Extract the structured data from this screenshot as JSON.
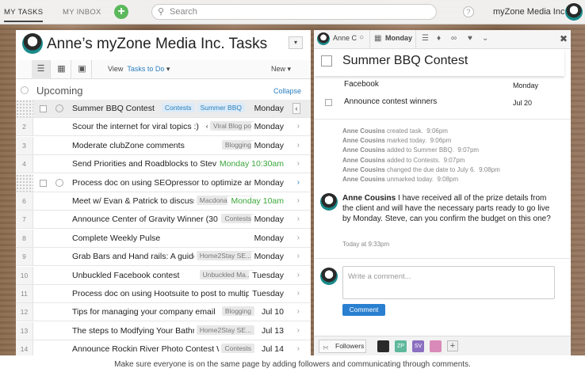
{
  "topbar": {
    "my_tasks": "MY TASKS",
    "my_inbox": "MY INBOX",
    "add": "+",
    "search_placeholder": "Search",
    "help": "?",
    "workspace": "myZone Media Inc."
  },
  "left": {
    "title": "Anne’s myZone Media Inc. Tasks",
    "dropdown": "▾",
    "view_label": "View",
    "view_value": "Tasks to Do",
    "new_label": "New",
    "upcoming": "Upcoming",
    "collapse": "Collapse",
    "rows": [
      {
        "num": "",
        "title": "Summer BBQ Contest",
        "tags": [
          "Contests",
          "Summer BBQ"
        ],
        "tag_style": "blue",
        "date": "Monday",
        "green": false,
        "selected": true
      },
      {
        "num": "2",
        "title": "Scour the internet for viral topics :)",
        "tags": [
          "Viral Blog po"
        ],
        "tag_style": "grey",
        "date": "Monday",
        "green": false
      },
      {
        "num": "3",
        "title": "Moderate clubZone comments",
        "tags": [
          "Blogging"
        ],
        "tag_style": "grey",
        "date": "Monday",
        "green": false
      },
      {
        "num": "4",
        "title": "Send Priorities and Roadblocks to Steve",
        "tags": [],
        "date": "Monday 10:30am",
        "green": true
      },
      {
        "num": "",
        "title": "Process doc on using SEOpressor to optimize articles",
        "tags": [],
        "date": "Monday",
        "green": false,
        "dragging": true
      },
      {
        "num": "6",
        "title": "Meet w/ Evan & Patrick to discuss",
        "tags": [
          "MacdonaldsHH..."
        ],
        "tag_style": "grey",
        "date": "Monday 10am",
        "green": true
      },
      {
        "num": "7",
        "title": "Announce Center of Gravity Winner (30",
        "tags": [
          "Contests"
        ],
        "tag_style": "grey",
        "date": "Monday",
        "green": false
      },
      {
        "num": "8",
        "title": "Complete Weekly Pulse",
        "tags": [],
        "date": "Monday",
        "green": false
      },
      {
        "num": "9",
        "title": "Grab Bars and Hand rails: A guide",
        "tags": [
          "Home2Stay SE..."
        ],
        "tag_style": "grey",
        "date": "Monday",
        "green": false
      },
      {
        "num": "10",
        "title": "Unbuckled Facebook contest",
        "tags": [
          "Unbuckled Ma..."
        ],
        "tag_style": "grey",
        "date": "Tuesday",
        "green": false
      },
      {
        "num": "11",
        "title": "Process doc on using Hootsuite to post to multiple",
        "tags": [],
        "date": "Tuesday",
        "green": false
      },
      {
        "num": "12",
        "title": "Tips for managing your company email",
        "tags": [
          "Blogging"
        ],
        "tag_style": "grey",
        "date": "Jul 10",
        "green": false
      },
      {
        "num": "13",
        "title": "The steps to Modfying Your Bathroom",
        "tags": [
          "Home2Stay SE..."
        ],
        "tag_style": "grey",
        "date": "Jul 13",
        "green": false
      },
      {
        "num": "14",
        "title": "Announce Rockin River Photo Contest Winner",
        "tags": [
          "Contests"
        ],
        "tag_style": "grey",
        "date": "Jul 14",
        "green": false
      }
    ]
  },
  "right": {
    "assignee": "Anne C",
    "due_tab": "Monday",
    "task_title": "Summer BBQ Contest",
    "subtasks": [
      {
        "title": "Facebook",
        "date": "Monday"
      },
      {
        "title": "Announce contest winners",
        "date": "Jul 20"
      }
    ],
    "activity": [
      {
        "who": "Anne Cousins",
        "what": "created task.",
        "when": "9:06pm"
      },
      {
        "who": "Anne Cousins",
        "what": "marked today.",
        "when": "9:06pm"
      },
      {
        "who": "Anne Cousins",
        "what": "added to Summer BBQ.",
        "when": "9:07pm"
      },
      {
        "who": "Anne Cousins",
        "what": "added to Contests.",
        "when": "9:07pm"
      },
      {
        "who": "Anne Cousins",
        "what": "changed the due date to July 6.",
        "when": "9:08pm"
      },
      {
        "who": "Anne Cousins",
        "what": "unmarked today.",
        "when": "9:08pm"
      }
    ],
    "comment": {
      "author": "Anne Cousins",
      "text": "I have received all of the prize details from the client and will have the necessary parts ready to go live by Monday. Steve, can you confirm the budget on this one?",
      "time": "Today at 9:33pm"
    },
    "comment_placeholder": "Write a comment...",
    "comment_button": "Comment",
    "followers_label": "Followers",
    "followers": [
      {
        "initials": "",
        "color": "#2a2a2a"
      },
      {
        "initials": "ZP",
        "color": "#5fb89c"
      },
      {
        "initials": "SV",
        "color": "#8b6fc0"
      },
      {
        "initials": "",
        "color": "#d98ab8"
      }
    ],
    "add_follower": "+"
  },
  "caption": "Make sure everyone is on the same page by adding followers and communicating through comments.",
  "colors": {
    "accent": "#2a7fbf",
    "green": "#3aa63a",
    "plus": "#5cb85c"
  }
}
